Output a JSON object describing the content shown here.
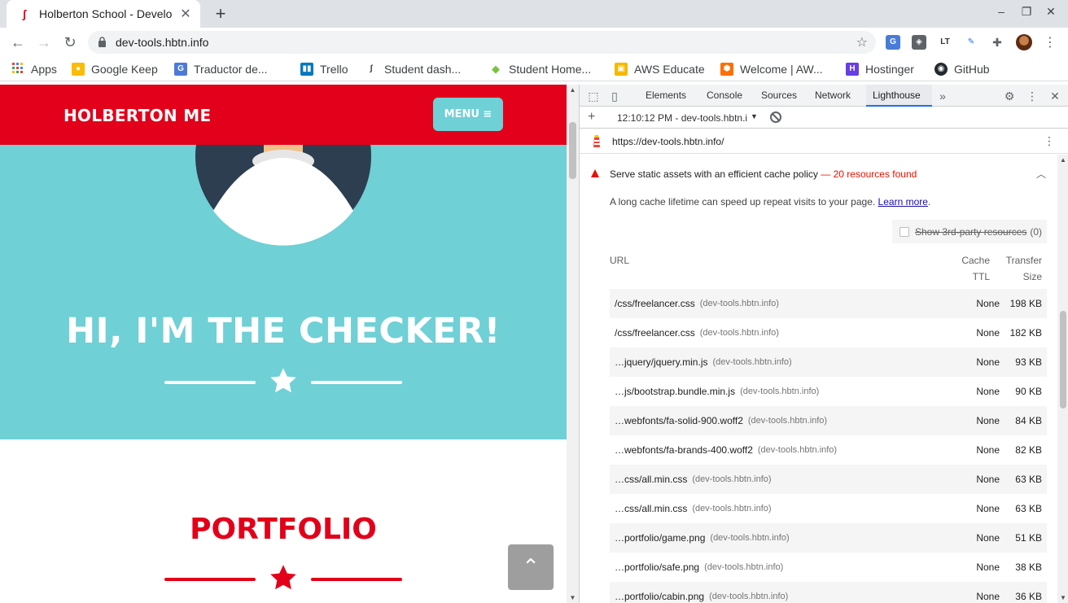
{
  "browser": {
    "tab_title": "Holberton School - Develo",
    "tab_close": "✕",
    "new_tab": "+",
    "url": "dev-tools.hbtn.info",
    "window_controls": {
      "minimize": "–",
      "restore": "❐",
      "close": "✕"
    }
  },
  "bookmarks": [
    {
      "label": "Apps",
      "icon": "apps-grid-icon"
    },
    {
      "label": "Google Keep",
      "icon": "keep-icon"
    },
    {
      "label": "Traductor de...",
      "icon": "translate-icon"
    },
    {
      "label": "Trello",
      "icon": "trello-icon"
    },
    {
      "label": "Student dash...",
      "icon": "holberton-icon"
    },
    {
      "label": "Student Home...",
      "icon": "diamond-icon"
    },
    {
      "label": "AWS Educate",
      "icon": "aws-cube-icon"
    },
    {
      "label": "Welcome | AW...",
      "icon": "aws-orange-icon"
    },
    {
      "label": "Hostinger",
      "icon": "hostinger-icon"
    },
    {
      "label": "GitHub",
      "icon": "github-icon"
    }
  ],
  "page": {
    "brand": "HOLBERTON ME",
    "menu_label": "MENU ≡",
    "hero_title": "HI, I'M THE CHECKER!",
    "portfolio_title": "PORTFOLIO",
    "to_top": "⌃",
    "colors": {
      "red": "#e2001a",
      "teal": "#6fd0d6"
    }
  },
  "devtools": {
    "tabs": [
      "Elements",
      "Console",
      "Sources",
      "Network",
      "Lighthouse"
    ],
    "active_tab": "Lighthouse",
    "overflow": "»",
    "report_time": "12:10:12 PM - dev-tools.hbtn.i",
    "report_url": "https://dev-tools.hbtn.info/",
    "audit": {
      "title": "Serve static assets with an efficient cache policy",
      "separator": "—",
      "count": "20 resources found",
      "description": "A long cache lifetime can speed up repeat visits to your page.",
      "learn_more": "Learn more",
      "third_party_label": "Show 3rd-party resources",
      "third_party_count": "(0)",
      "headers": {
        "url": "URL",
        "cache1": "Cache",
        "cache2": "TTL",
        "size1": "Transfer",
        "size2": "Size"
      },
      "rows": [
        {
          "path": "/css/freelancer.css",
          "host": "(dev-tools.hbtn.info)",
          "ttl": "None",
          "size": "198 KB"
        },
        {
          "path": "/css/freelancer.css",
          "host": "(dev-tools.hbtn.info)",
          "ttl": "None",
          "size": "182 KB"
        },
        {
          "path": "…jquery/jquery.min.js",
          "host": "(dev-tools.hbtn.info)",
          "ttl": "None",
          "size": "93 KB"
        },
        {
          "path": "…js/bootstrap.bundle.min.js",
          "host": "(dev-tools.hbtn.info)",
          "ttl": "None",
          "size": "90 KB"
        },
        {
          "path": "…webfonts/fa-solid-900.woff2",
          "host": "(dev-tools.hbtn.info)",
          "ttl": "None",
          "size": "84 KB"
        },
        {
          "path": "…webfonts/fa-brands-400.woff2",
          "host": "(dev-tools.hbtn.info)",
          "ttl": "None",
          "size": "82 KB"
        },
        {
          "path": "…css/all.min.css",
          "host": "(dev-tools.hbtn.info)",
          "ttl": "None",
          "size": "63 KB"
        },
        {
          "path": "…css/all.min.css",
          "host": "(dev-tools.hbtn.info)",
          "ttl": "None",
          "size": "63 KB"
        },
        {
          "path": "…portfolio/game.png",
          "host": "(dev-tools.hbtn.info)",
          "ttl": "None",
          "size": "51 KB"
        },
        {
          "path": "…portfolio/safe.png",
          "host": "(dev-tools.hbtn.info)",
          "ttl": "None",
          "size": "38 KB"
        },
        {
          "path": "…portfolio/cabin.png",
          "host": "(dev-tools.hbtn.info)",
          "ttl": "None",
          "size": "36 KB"
        }
      ]
    }
  }
}
